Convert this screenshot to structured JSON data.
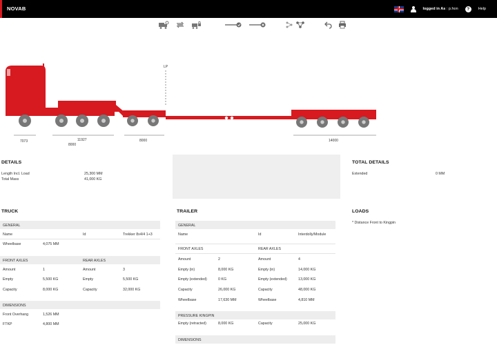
{
  "header": {
    "brand": "NOVAB",
    "logged_in_label": "logged in As",
    "username": ": p.hon",
    "help_label": "Help"
  },
  "icons": {
    "flag": "uk-flag-icon",
    "user": "user-icon",
    "help": "help-icon"
  },
  "colors": {
    "brand_red": "#d71920",
    "topbar": "#000000",
    "panel": "#efefef"
  },
  "drawing": {
    "lp_label": "LP",
    "dim_tractor": "7073",
    "dim_dolly": "11927",
    "dim_dolly_sub": "8000",
    "dim_front_bogie": "8000",
    "dim_rear": "14000"
  },
  "details": {
    "title": "DETAILS",
    "rows": [
      {
        "label": "Length Incl. Load",
        "value": "25,300 MM"
      },
      {
        "label": "Total Mass",
        "value": "41,000 KG"
      }
    ]
  },
  "total_details": {
    "title": "TOTAL DETAILS",
    "rows": [
      {
        "label": "Extended",
        "value": "0 MM"
      }
    ]
  },
  "truck": {
    "title": "TRUCK",
    "general_title": "GENERAL",
    "name_label": "Name",
    "id_label": "Id",
    "id_value": "Trekker 8x4/4 1+3",
    "wheelbase_label": "Wheelbase",
    "wheelbase_value": "4,075 MM",
    "front_axles_title": "FRONT AXLES",
    "rear_axles_title": "REAR AXLES",
    "front": [
      {
        "label": "Amount",
        "value": "1"
      },
      {
        "label": "Empty",
        "value": "5,500 KG"
      },
      {
        "label": "Capacity",
        "value": "8,000 KG"
      }
    ],
    "rear": [
      {
        "label": "Amount",
        "value": "3"
      },
      {
        "label": "Empty",
        "value": "5,500 KG"
      },
      {
        "label": "Capacity",
        "value": "32,000 KG"
      }
    ],
    "dimensions_title": "DIMENSIONS",
    "dimensions": [
      {
        "label": "Front Overhang",
        "value": "1,526 MM"
      },
      {
        "label": "FTKP",
        "value": "4,800 MM"
      }
    ]
  },
  "trailer": {
    "title": "TRAILER",
    "general_title": "GENERAL",
    "name_label": "Name",
    "id_label": "Id",
    "id_value": "Interdolly/Module",
    "front_axles_title": "FRONT AXLES",
    "rear_axles_title": "REAR AXLES",
    "front": [
      {
        "label": "Amount",
        "value": "2"
      },
      {
        "label": "Empty (in)",
        "value": "8,000 KG"
      },
      {
        "label": "Empty (extended)",
        "value": "0 KG"
      },
      {
        "label": "Capacity",
        "value": "26,000 KG"
      },
      {
        "label": "Wheelbase",
        "value": "17,630 MM"
      }
    ],
    "rear": [
      {
        "label": "Amount",
        "value": "4"
      },
      {
        "label": "Empty (in)",
        "value": "14,000 KG"
      },
      {
        "label": "Empty (extended)",
        "value": "13,000 KG"
      },
      {
        "label": "Capacity",
        "value": "48,000 KG"
      },
      {
        "label": "Wheelbase",
        "value": "4,810 MM"
      }
    ],
    "kingpin_title": "PRESSURE KINGPIN",
    "kingpin": [
      {
        "label": "Empty (retracted)",
        "value": "8,000 KG"
      },
      {
        "label": "Capacity",
        "value": "25,000 KG"
      }
    ],
    "dimensions_title": "DIMENSIONS"
  },
  "loads": {
    "title": "LOADS",
    "note": "* Distance Front to Kingpin"
  }
}
